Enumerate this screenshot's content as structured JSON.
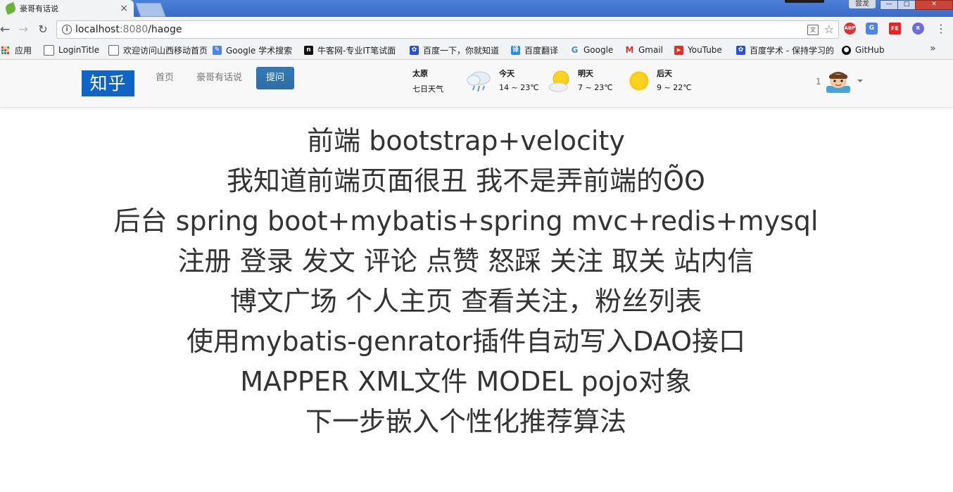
{
  "browser": {
    "tab_title": "豪哥有话说",
    "window_user": "尝龙",
    "url_host": "localhost",
    "url_port": ":8080",
    "url_path": "/haoge",
    "extensions": [
      "ABP",
      "G",
      "FE",
      "R"
    ]
  },
  "bookmarks": [
    {
      "label": "应用",
      "icon": "apps-grid-icon"
    },
    {
      "label": "LoginTitle",
      "icon": "page-icon"
    },
    {
      "label": "欢迎访问山西移动首页",
      "icon": "page-icon"
    },
    {
      "label": "Google 学术搜索",
      "icon": "google-scholar-icon"
    },
    {
      "label": "牛客网-专业IT笔试面",
      "icon": "nowcoder-icon"
    },
    {
      "label": "百度一下，你就知道",
      "icon": "baidu-paw-icon"
    },
    {
      "label": "百度翻译",
      "icon": "baidu-translate-icon"
    },
    {
      "label": "Google",
      "icon": "google-g-icon"
    },
    {
      "label": "Gmail",
      "icon": "gmail-icon"
    },
    {
      "label": "YouTube",
      "icon": "youtube-icon"
    },
    {
      "label": "百度学术 - 保持学习的",
      "icon": "baidu-paw-icon"
    },
    {
      "label": "GitHub",
      "icon": "github-icon"
    }
  ],
  "navbar": {
    "brand": "知乎",
    "links": [
      "首页",
      "豪哥有话说"
    ],
    "ask_button": "提问",
    "user_count": "1"
  },
  "weather": {
    "city": "太原",
    "subtitle": "七日天气",
    "days": [
      {
        "label": "今天",
        "temp": "14 ~ 23℃",
        "icon": "rain-cloud-icon"
      },
      {
        "label": "明天",
        "temp": "7 ~ 23℃",
        "icon": "sun-cloud-icon"
      },
      {
        "label": "后天",
        "temp": "9 ~ 22℃",
        "icon": "sun-icon"
      }
    ]
  },
  "content": {
    "lines": [
      "前端 bootstrap+velocity",
      "我知道前端页面很丑 我不是弄前端的ʘ̃ʘ",
      "后台 spring boot+mybatis+spring mvc+redis+mysql",
      "注册 登录 发文 评论 点赞 怒踩 关注 取关 站内信",
      "博文广场 个人主页 查看关注，粉丝列表",
      "使用mybatis-genrator插件自动写入DAO接口",
      "MAPPER XML文件 MODEL pojo对象",
      "下一步嵌入个性化推荐算法"
    ]
  },
  "colors": {
    "brand_bg": "#0f65c6",
    "ask_button_bg": "#337ab7",
    "navbar_bg": "#f8f8f8",
    "text": "#333333"
  }
}
